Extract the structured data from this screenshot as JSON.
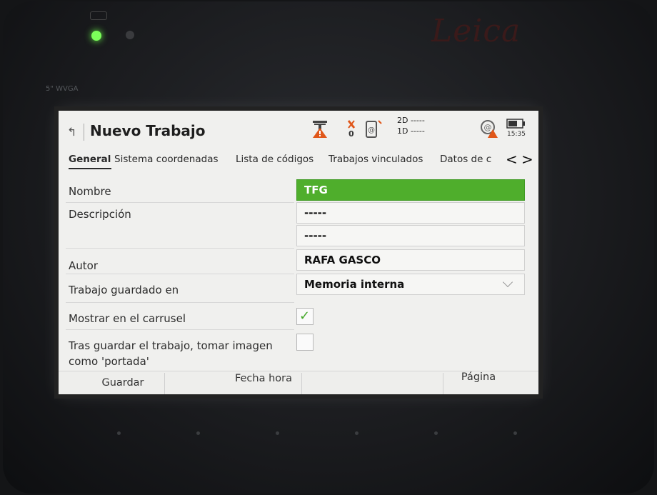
{
  "device": {
    "brand": "Leica",
    "model_label": "5\" WVGA"
  },
  "titlebar": {
    "title": "Nuevo Trabajo",
    "satellite_count": "0",
    "dim_2d": "2D -----",
    "dim_1d": "1D -----",
    "time": "15:35"
  },
  "tabs": {
    "items": [
      "General",
      "Sistema coordenadas",
      "Lista de códigos",
      "Trabajos vinculados",
      "Datos de c"
    ],
    "active": "General",
    "prev": "<",
    "next": ">"
  },
  "form": {
    "nombre": {
      "label": "Nombre",
      "value": "TFG"
    },
    "descripcion": {
      "label": "Descripción",
      "value1": "-----",
      "value2": "-----"
    },
    "autor": {
      "label": "Autor",
      "value": "RAFA GASCO"
    },
    "guardado": {
      "label": "Trabajo guardado en",
      "value": "Memoria interna"
    },
    "carrusel": {
      "label": "Mostrar en el carrusel",
      "checked": true
    },
    "portada": {
      "label": "Tras guardar el trabajo, tomar imagen como 'portada'",
      "checked": false
    }
  },
  "softkeys": {
    "f1": "Guardar",
    "f2": "Fecha hora",
    "f6": "Página"
  },
  "colors": {
    "accent_green": "#4fae2c",
    "warning_orange": "#e0571a",
    "led_green": "#7cff5a"
  }
}
